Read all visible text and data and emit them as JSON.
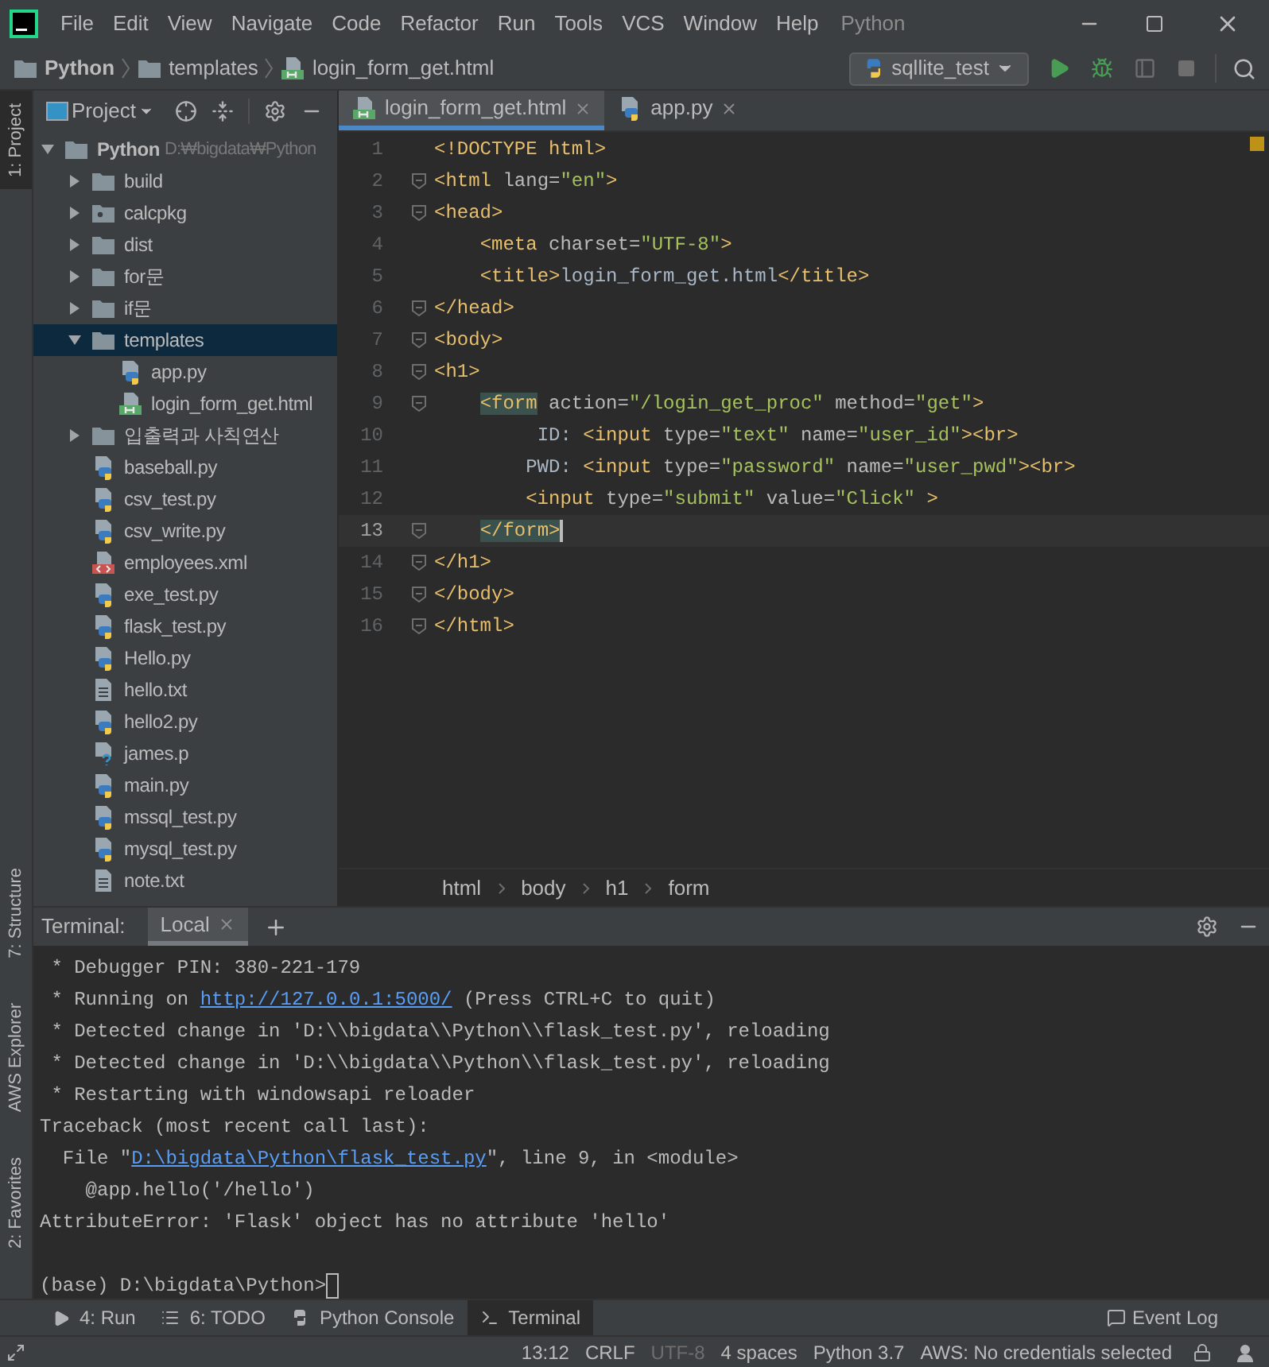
{
  "window": {
    "menu": [
      "File",
      "Edit",
      "View",
      "Navigate",
      "Code",
      "Refactor",
      "Run",
      "Tools",
      "VCS",
      "Window",
      "Help"
    ],
    "project_title": "Python"
  },
  "navbar": {
    "breadcrumbs": [
      {
        "label": "Python",
        "kind": "folder"
      },
      {
        "label": "templates",
        "kind": "folder"
      },
      {
        "label": "login_form_get.html",
        "kind": "html"
      }
    ],
    "run_config": "sqllite_test"
  },
  "side_strip": {
    "top": [
      {
        "label": "1: Project",
        "selected": true
      }
    ],
    "bottom": [
      {
        "label": "7: Structure",
        "selected": false
      },
      {
        "label": "AWS Explorer",
        "selected": false
      },
      {
        "label": "2: Favorites",
        "selected": false
      }
    ]
  },
  "project": {
    "title": "Project",
    "tree": [
      {
        "name": "Python",
        "path": "D:₩bigdata₩Python",
        "kind": "folder",
        "expanded": true,
        "selected": false,
        "children": [
          {
            "name": "build",
            "kind": "folder",
            "expanded": false,
            "selected": false
          },
          {
            "name": "calcpkg",
            "kind": "package",
            "expanded": false,
            "selected": false
          },
          {
            "name": "dist",
            "kind": "folder",
            "expanded": false,
            "selected": false
          },
          {
            "name": "for문",
            "kind": "folder",
            "expanded": false,
            "selected": false
          },
          {
            "name": "if문",
            "kind": "folder",
            "expanded": false,
            "selected": false
          },
          {
            "name": "templates",
            "kind": "folder",
            "expanded": true,
            "selected": true,
            "children": [
              {
                "name": "app.py",
                "kind": "py",
                "selected": false
              },
              {
                "name": "login_form_get.html",
                "kind": "html",
                "selected": false
              }
            ]
          },
          {
            "name": "입출력과 사칙연산",
            "kind": "folder",
            "expanded": false,
            "selected": false
          },
          {
            "name": "baseball.py",
            "kind": "py",
            "selected": false
          },
          {
            "name": "csv_test.py",
            "kind": "py",
            "selected": false
          },
          {
            "name": "csv_write.py",
            "kind": "py",
            "selected": false
          },
          {
            "name": "employees.xml",
            "kind": "xml",
            "selected": false
          },
          {
            "name": "exe_test.py",
            "kind": "py",
            "selected": false
          },
          {
            "name": "flask_test.py",
            "kind": "py",
            "selected": false
          },
          {
            "name": "Hello.py",
            "kind": "py",
            "selected": false
          },
          {
            "name": "hello.txt",
            "kind": "txt",
            "selected": false
          },
          {
            "name": "hello2.py",
            "kind": "py",
            "selected": false
          },
          {
            "name": "james.p",
            "kind": "unknown",
            "selected": false
          },
          {
            "name": "main.py",
            "kind": "py",
            "selected": false
          },
          {
            "name": "mssql_test.py",
            "kind": "py",
            "selected": false
          },
          {
            "name": "mysql_test.py",
            "kind": "py",
            "selected": false
          },
          {
            "name": "note.txt",
            "kind": "txt",
            "selected": false
          }
        ]
      }
    ]
  },
  "editor": {
    "tabs": [
      {
        "label": "login_form_get.html",
        "kind": "html",
        "selected": true
      },
      {
        "label": "app.py",
        "kind": "py",
        "selected": false
      }
    ],
    "lines": [
      {
        "number": "1",
        "fold": false,
        "current": false,
        "tokens": [
          {
            "kind": "tag",
            "text": "<!DOCTYPE html>"
          }
        ]
      },
      {
        "number": "2",
        "fold": true,
        "current": false,
        "tokens": [
          {
            "kind": "tag",
            "text": "<html"
          },
          {
            "kind": "attr",
            "text": " lang="
          },
          {
            "kind": "value",
            "text": "\"en\""
          },
          {
            "kind": "tag",
            "text": ">"
          }
        ]
      },
      {
        "number": "3",
        "fold": true,
        "current": false,
        "tokens": [
          {
            "kind": "tag",
            "text": "<head>"
          }
        ]
      },
      {
        "number": "4",
        "fold": false,
        "current": false,
        "tokens": [
          {
            "kind": "tag",
            "text": "    <meta"
          },
          {
            "kind": "attr",
            "text": " charset="
          },
          {
            "kind": "value",
            "text": "\"UTF-8\""
          },
          {
            "kind": "tag",
            "text": ">"
          }
        ]
      },
      {
        "number": "5",
        "fold": false,
        "current": false,
        "tokens": [
          {
            "kind": "tag",
            "text": "    <title>"
          },
          {
            "kind": "text",
            "text": "login_form_get.html"
          },
          {
            "kind": "tag",
            "text": "</title>"
          }
        ]
      },
      {
        "number": "6",
        "fold": true,
        "current": false,
        "tokens": [
          {
            "kind": "tag",
            "text": "</head>"
          }
        ]
      },
      {
        "number": "7",
        "fold": true,
        "current": false,
        "tokens": [
          {
            "kind": "tag",
            "text": "<body>"
          }
        ]
      },
      {
        "number": "8",
        "fold": true,
        "current": false,
        "tokens": [
          {
            "kind": "tag",
            "text": "<h1>"
          }
        ]
      },
      {
        "number": "9",
        "fold": true,
        "current": false,
        "tokens": [
          {
            "kind": "tag",
            "text": "    <form",
            "highlight": true
          },
          {
            "kind": "attr",
            "text": " action="
          },
          {
            "kind": "value",
            "text": "\"/login_get_proc\""
          },
          {
            "kind": "attr",
            "text": " method="
          },
          {
            "kind": "value",
            "text": "\"get\""
          },
          {
            "kind": "tag",
            "text": ">"
          }
        ]
      },
      {
        "number": "10",
        "fold": false,
        "current": false,
        "tokens": [
          {
            "kind": "text",
            "text": "         ID: "
          },
          {
            "kind": "tag",
            "text": "<input"
          },
          {
            "kind": "attr",
            "text": " type="
          },
          {
            "kind": "value",
            "text": "\"text\""
          },
          {
            "kind": "attr",
            "text": " name="
          },
          {
            "kind": "value",
            "text": "\"user_id\""
          },
          {
            "kind": "tag",
            "text": "><br>"
          }
        ]
      },
      {
        "number": "11",
        "fold": false,
        "current": false,
        "tokens": [
          {
            "kind": "text",
            "text": "        PWD: "
          },
          {
            "kind": "tag",
            "text": "<input"
          },
          {
            "kind": "attr",
            "text": " type="
          },
          {
            "kind": "value",
            "text": "\"password\""
          },
          {
            "kind": "attr",
            "text": " name="
          },
          {
            "kind": "value",
            "text": "\"user_pwd\""
          },
          {
            "kind": "tag",
            "text": "><br>"
          }
        ]
      },
      {
        "number": "12",
        "fold": false,
        "current": false,
        "tokens": [
          {
            "kind": "tag",
            "text": "        <input"
          },
          {
            "kind": "attr",
            "text": " type="
          },
          {
            "kind": "value",
            "text": "\"submit\""
          },
          {
            "kind": "attr",
            "text": " value="
          },
          {
            "kind": "value",
            "text": "\"Click\""
          },
          {
            "kind": "tag",
            "text": " >"
          }
        ]
      },
      {
        "number": "13",
        "fold": true,
        "current": true,
        "tokens": [
          {
            "kind": "tag",
            "text": "    </form>",
            "highlight": true
          }
        ]
      },
      {
        "number": "14",
        "fold": true,
        "current": false,
        "tokens": [
          {
            "kind": "tag",
            "text": "</h1>"
          }
        ]
      },
      {
        "number": "15",
        "fold": true,
        "current": false,
        "tokens": [
          {
            "kind": "tag",
            "text": "</body>"
          }
        ]
      },
      {
        "number": "16",
        "fold": true,
        "current": false,
        "tokens": [
          {
            "kind": "tag",
            "text": "</html>"
          }
        ]
      }
    ],
    "breadcrumbs": [
      "html",
      "body",
      "h1",
      "form"
    ]
  },
  "terminal": {
    "title": "Terminal:",
    "tabs": [
      {
        "label": "Local",
        "selected": true
      }
    ],
    "lines": [
      [
        {
          "text": " * Debugger PIN: 380-221-179"
        }
      ],
      [
        {
          "text": " * Running on "
        },
        {
          "text": "http://127.0.0.1:5000/",
          "link": true
        },
        {
          "text": " (Press CTRL+C to quit)"
        }
      ],
      [
        {
          "text": " * Detected change in 'D:\\\\bigdata\\\\Python\\\\flask_test.py', reloading"
        }
      ],
      [
        {
          "text": " * Detected change in 'D:\\\\bigdata\\\\Python\\\\flask_test.py', reloading"
        }
      ],
      [
        {
          "text": " * Restarting with windowsapi reloader"
        }
      ],
      [
        {
          "text": "Traceback (most recent call last):"
        }
      ],
      [
        {
          "text": "  File \""
        },
        {
          "text": "D:\\bigdata\\Python\\flask_test.py",
          "link": true
        },
        {
          "text": "\", line 9, in <module>"
        }
      ],
      [
        {
          "text": "    @app.hello('/hello')"
        }
      ],
      [
        {
          "text": "AttributeError: 'Flask' object has no attribute 'hello'"
        }
      ]
    ],
    "prompt": "(base) D:\\bigdata\\Python>"
  },
  "tool_tabs": [
    {
      "label": "4: Run",
      "kind": "run",
      "selected": false
    },
    {
      "label": "6: TODO",
      "kind": "todo",
      "selected": false
    },
    {
      "label": "Python Console",
      "kind": "console",
      "selected": false
    },
    {
      "label": "Terminal",
      "kind": "terminal",
      "selected": true
    }
  ],
  "event_log": "Event Log",
  "status_bar": [
    {
      "text": "13:12",
      "disabled": false
    },
    {
      "text": "CRLF",
      "disabled": false
    },
    {
      "text": "UTF-8",
      "disabled": true
    },
    {
      "text": "4 spaces",
      "disabled": false
    },
    {
      "text": "Python 3.7",
      "disabled": false
    },
    {
      "text": "AWS: No credentials selected",
      "disabled": false
    }
  ]
}
